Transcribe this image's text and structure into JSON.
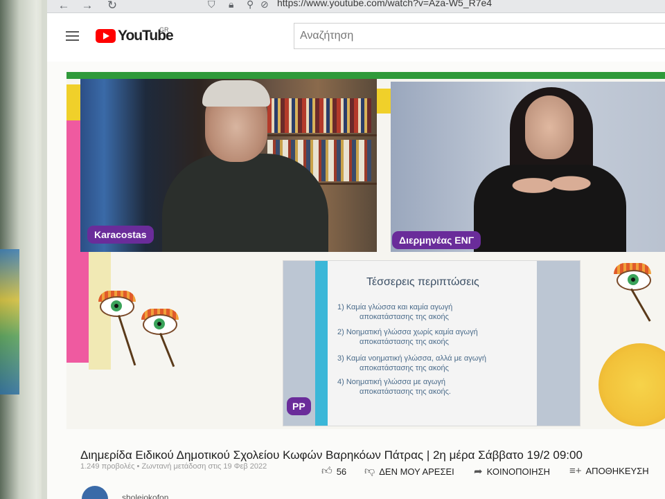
{
  "browser": {
    "url": "https://www.youtube.com/watch?v=Aza-W5_R7e4",
    "back_icon": "←",
    "forward_icon": "→",
    "reload_icon": "↻"
  },
  "youtube": {
    "logo_text": "YouTube",
    "country_code": "GR",
    "search_placeholder": "Αναζήτηση"
  },
  "video": {
    "speaker_left_label": "Karacostas",
    "speaker_right_label": "Διερμηνέας ΕΝΓ",
    "slide": {
      "title": "Τέσσερεις περιπτώσεις",
      "items": [
        {
          "line1": "1) Καμία γλώσσα και καμία αγωγή",
          "line2": "αποκατάστασης της ακοής"
        },
        {
          "line1": "2) Νοηματική γλώσσα χωρίς καμία αγωγή",
          "line2": "αποκατάστασης της ακοής"
        },
        {
          "line1": "3) Καμία νοηματική γλώσσα, αλλά με αγωγή",
          "line2": "αποκατάστασης της ακοής"
        },
        {
          "line1": "4) Νοηματική γλώσσα με αγωγή",
          "line2": "αποκατάστασης της ακοής."
        }
      ],
      "badge": "PP"
    }
  },
  "info": {
    "title": "Διημερίδα Ειδικού Δημοτικού Σχολείου Κωφών Βαρηκόων Πάτρας | 2η μέρα Σάββατο 19/2 09:00",
    "meta": "1.249 προβολές • Ζωντανή μετάδοση στις 19 Φεβ 2022",
    "like_count": "56",
    "dislike_label": "ΔΕΝ ΜΟΥ ΑΡΕΣΕΙ",
    "share_label": "ΚΟΙΝΟΠΟΙΗΣΗ",
    "save_label": "ΑΠΟΘΗΚΕΥΣΗ",
    "channel_name": "sholeiokofon"
  },
  "colors": {
    "accent_red": "#ff0000",
    "pill_purple": "#6a2c9a",
    "stripe_green": "#2f9a3a"
  }
}
